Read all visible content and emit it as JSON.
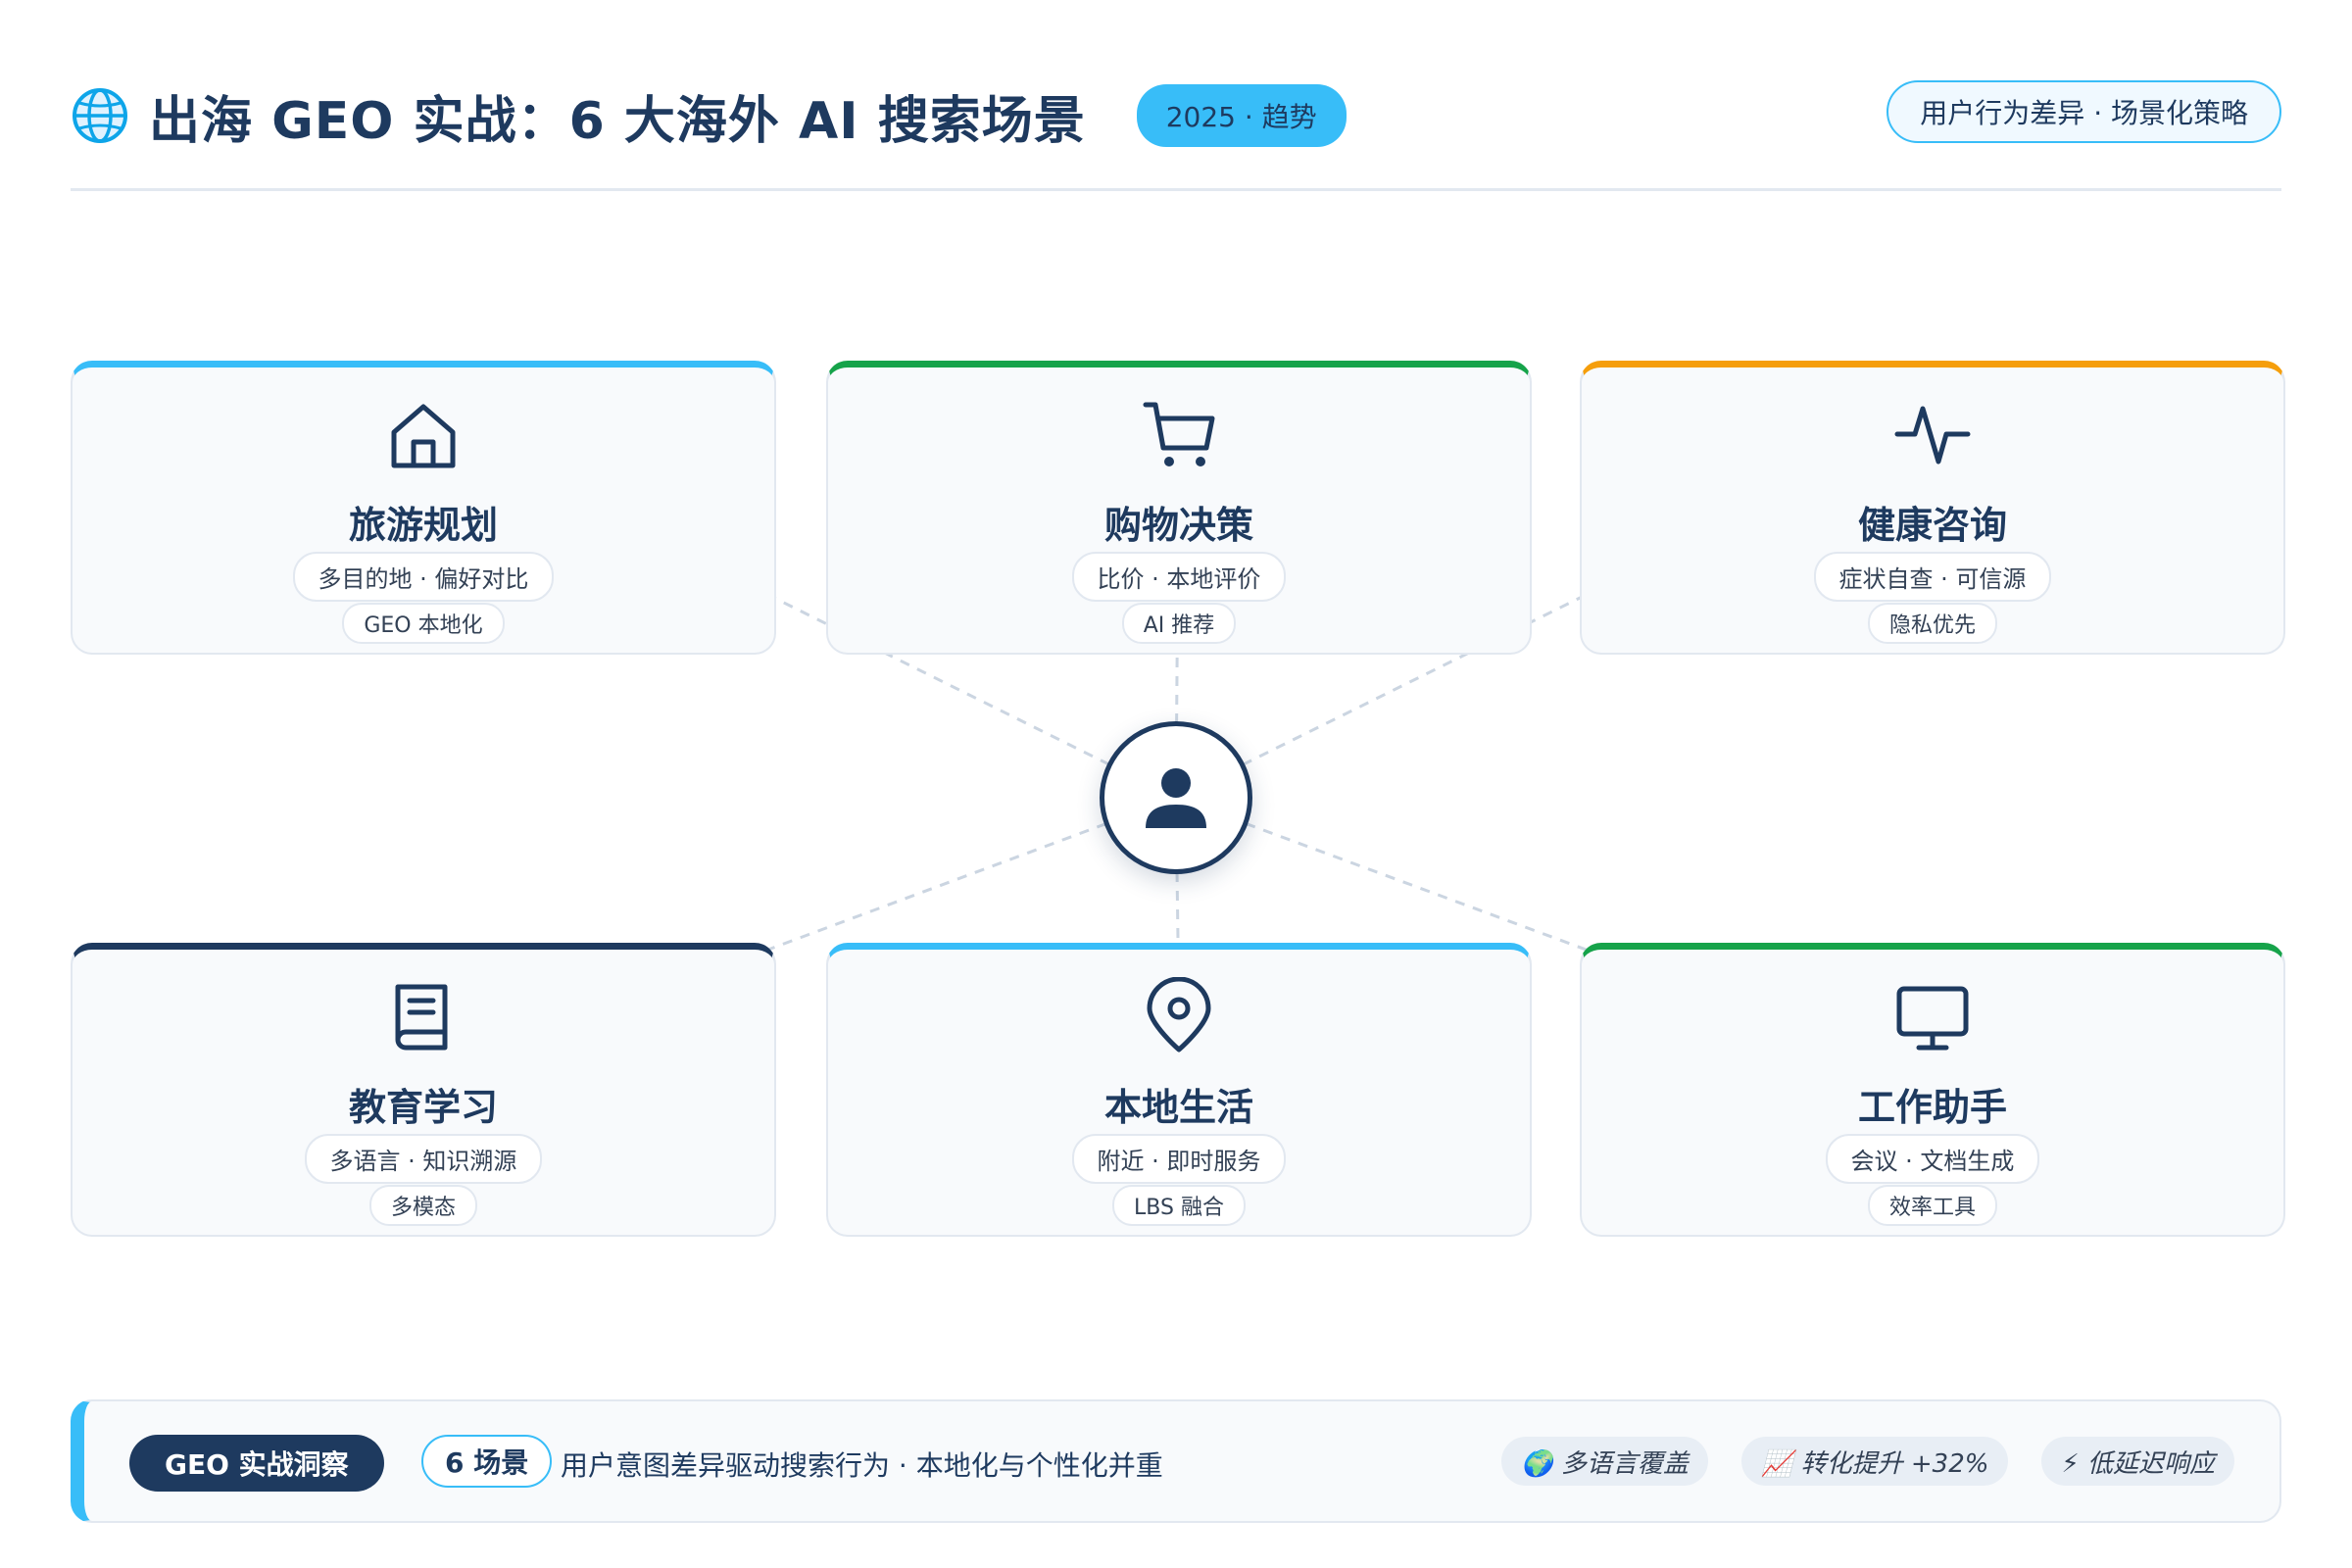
{
  "header": {
    "title": "出海 GEO 实战：6 大海外 AI 搜索场景",
    "badge": "2025 · 趋势",
    "right_pill": "用户行为差异 · 场景化策略"
  },
  "cards": [
    {
      "name": "旅游规划",
      "icon": "home-icon",
      "tag_main": "多目的地 · 偏好对比",
      "tag_sub": "GEO 本地化",
      "accent": "#38bdf8"
    },
    {
      "name": "购物决策",
      "icon": "shopping-cart-icon",
      "tag_main": "比价 · 本地评价",
      "tag_sub": "AI 推荐",
      "accent": "#16a34a"
    },
    {
      "name": "健康咨询",
      "icon": "pulse-icon",
      "tag_main": "症状自查 · 可信源",
      "tag_sub": "隐私优先",
      "accent": "#f59e0b"
    },
    {
      "name": "教育学习",
      "icon": "book-icon",
      "tag_main": "多语言 · 知识溯源",
      "tag_sub": "多模态",
      "accent": "#1e3a5f"
    },
    {
      "name": "本地生活",
      "icon": "map-pin-icon",
      "tag_main": "附近 · 即时服务",
      "tag_sub": "LBS 融合",
      "accent": "#38bdf8"
    },
    {
      "name": "工作助手",
      "icon": "monitor-icon",
      "tag_main": "会议 · 文档生成",
      "tag_sub": "效率工具",
      "accent": "#16a34a"
    }
  ],
  "hub": {
    "icon": "user-icon"
  },
  "footer": {
    "insight_label": "GEO 实战洞察",
    "count_label": "6 场景",
    "text": "用户意图差异驱动搜索行为 · 本地化与个性化并重",
    "metrics": [
      "🌍 多语言覆盖",
      "📈 转化提升 +32%",
      "⚡ 低延迟响应"
    ]
  },
  "colors": {
    "navy": "#1e3a5f",
    "sky": "#38bdf8",
    "green": "#16a34a",
    "amber": "#f59e0b"
  }
}
